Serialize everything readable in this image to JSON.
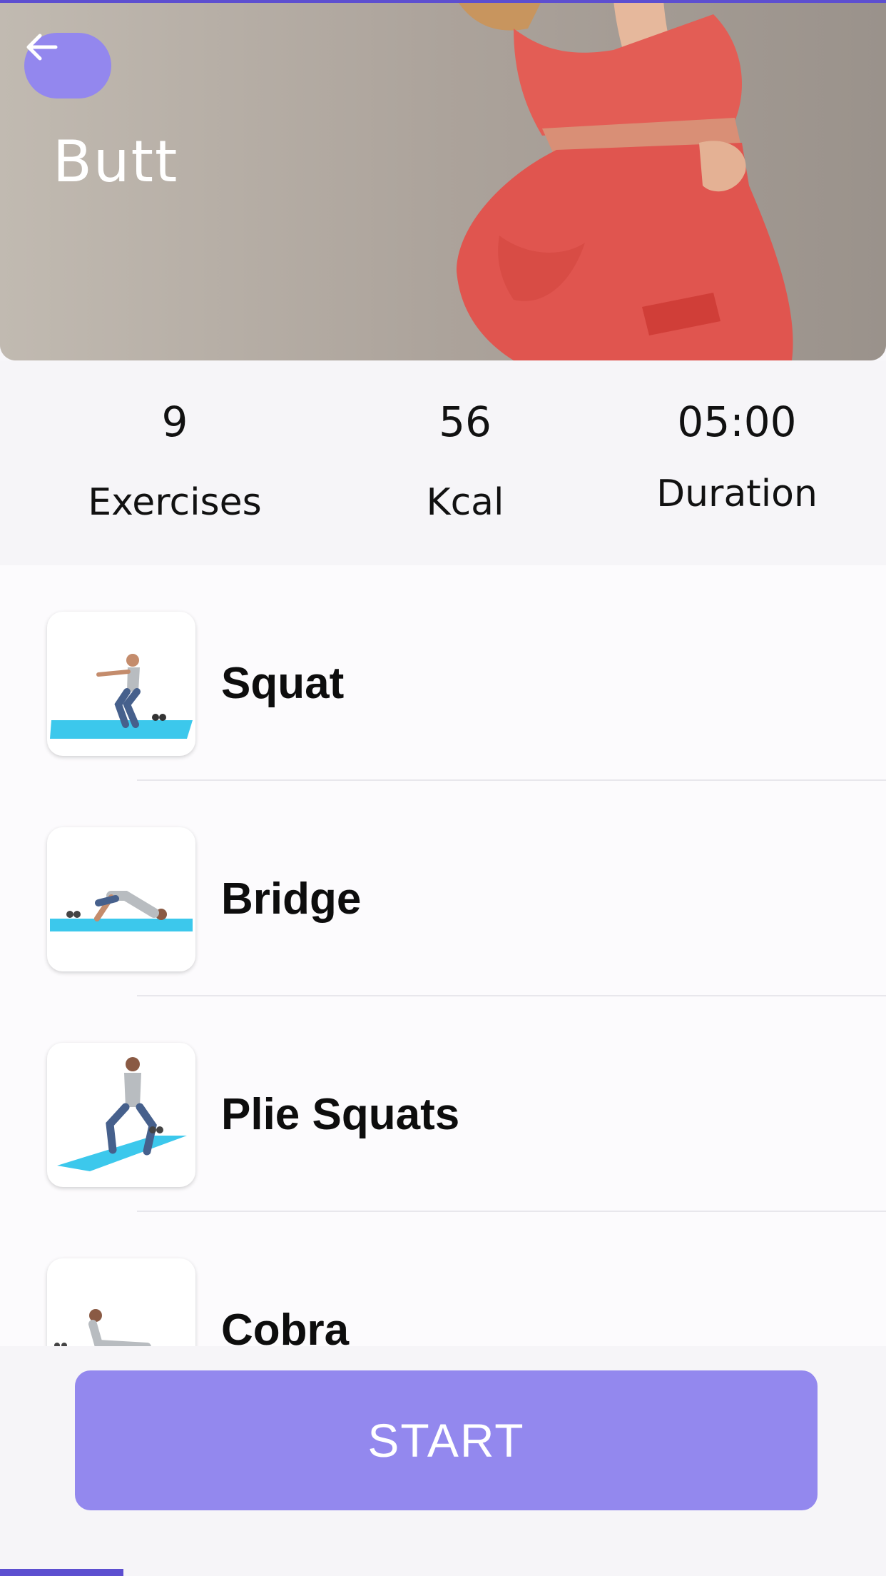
{
  "header": {
    "title": "Butt",
    "back_icon": "arrow-left-icon",
    "accent_color": "#9387ee"
  },
  "stats": [
    {
      "value": "9",
      "label": "Exercises"
    },
    {
      "value": "56",
      "label": "Kcal"
    },
    {
      "value": "05:00",
      "label": "Duration"
    }
  ],
  "exercises": [
    {
      "name": "Squat",
      "icon": "squat-illustration"
    },
    {
      "name": "Bridge",
      "icon": "bridge-illustration"
    },
    {
      "name": "Plie Squats",
      "icon": "plie-squats-illustration"
    },
    {
      "name": "Cobra",
      "icon": "cobra-illustration"
    }
  ],
  "footer": {
    "start_label": "START"
  }
}
